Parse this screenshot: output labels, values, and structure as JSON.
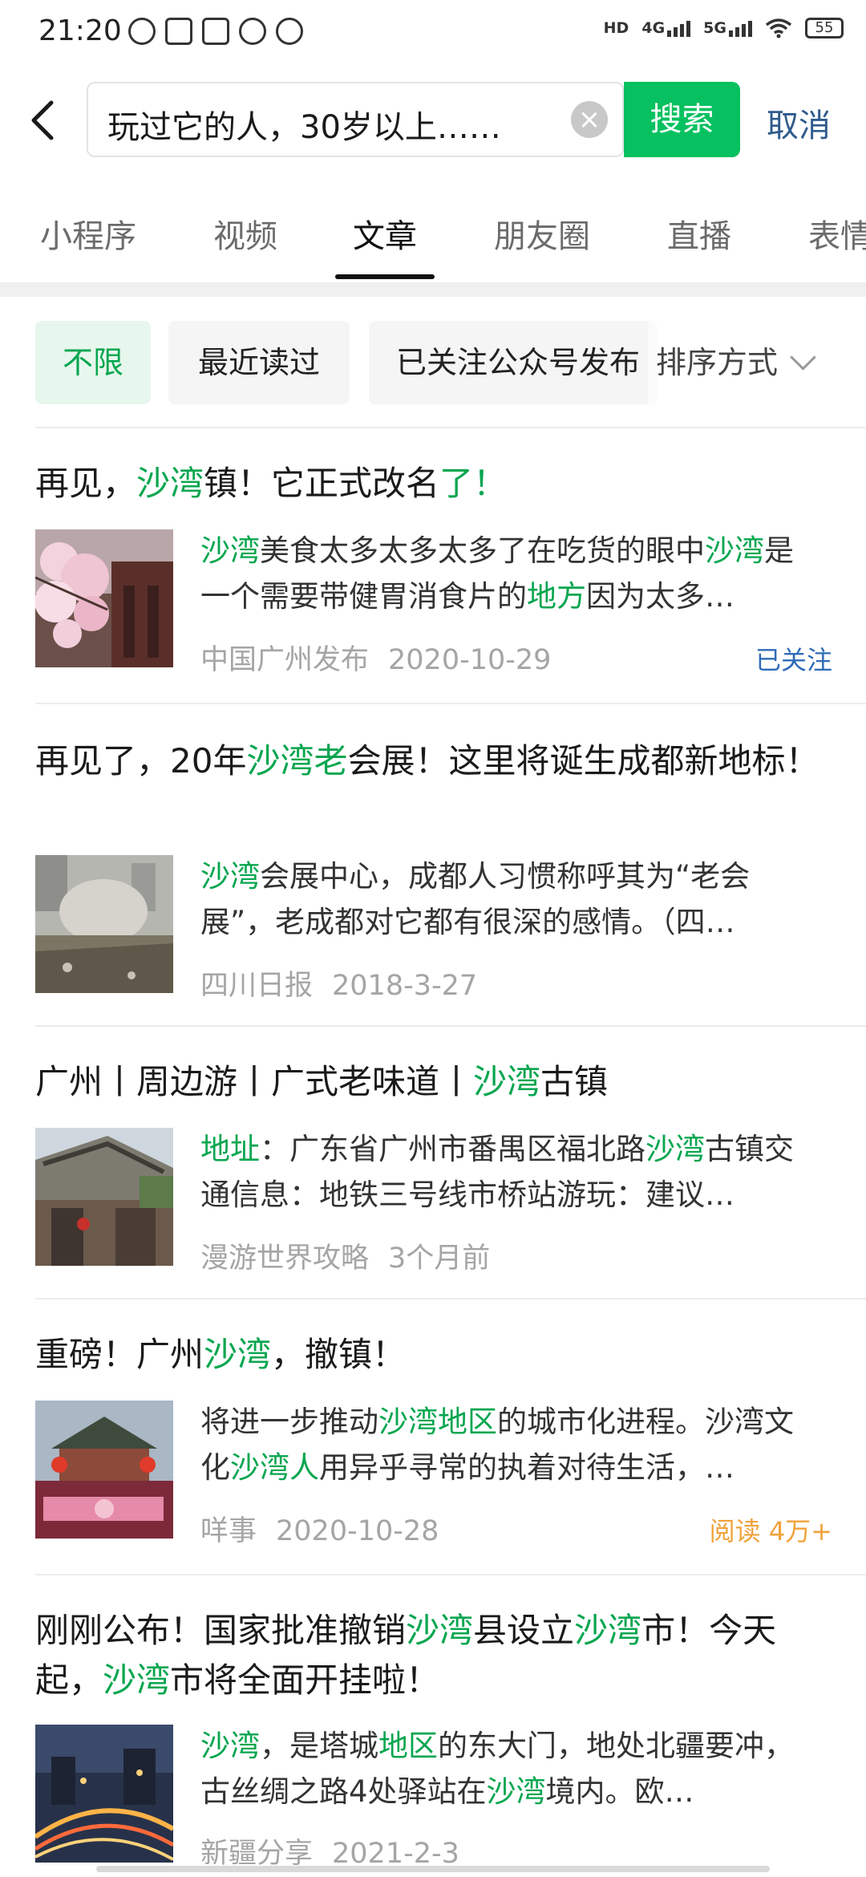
{
  "status_bar": {
    "time": "21:20",
    "network_left": "HD",
    "network_4g": "4G",
    "network_5g": "5G",
    "battery": "55"
  },
  "search": {
    "query": "玩过它的人，30岁以上……",
    "search_button": "搜索",
    "cancel": "取消"
  },
  "tabs": [
    "小程序",
    "视频",
    "文章",
    "朋友圈",
    "直播",
    "表情"
  ],
  "active_tab": "文章",
  "filters": {
    "chips": [
      "不限",
      "最近读过",
      "已关注公众号发布"
    ],
    "sort": "排序方式"
  },
  "articles": [
    {
      "title": [
        [
          "再见，",
          0
        ],
        [
          "沙湾",
          1
        ],
        [
          "镇！它正式改名",
          0
        ],
        [
          "了！",
          1
        ]
      ],
      "summary": [
        [
          "沙湾",
          1
        ],
        [
          "美食太多太多太多了在吃货的眼中",
          0
        ],
        [
          "沙湾",
          1
        ],
        [
          "是一个需要带健胃消食片的",
          0
        ],
        [
          "地方",
          1
        ],
        [
          "因为太多…",
          0
        ]
      ],
      "source": "中国广州发布",
      "date": "2020-10-29",
      "badge": "已关注",
      "thumb": "cherry-blossom-photo"
    },
    {
      "title": [
        [
          "再见了，20年",
          0
        ],
        [
          "沙湾老",
          1
        ],
        [
          "会展！这里将诞生成都新地标！",
          0
        ]
      ],
      "summary": [
        [
          "沙湾",
          1
        ],
        [
          "会展中心，成都人习惯称呼其为“老会展”，老成都对它都有很深的感情。（四…",
          0
        ]
      ],
      "source": "四川日报",
      "date": "2018-3-27",
      "badge": "",
      "thumb": "demolition-photo"
    },
    {
      "title": [
        [
          "广州丨周边游丨广式老味道丨",
          0
        ],
        [
          "沙湾",
          1
        ],
        [
          "古镇",
          0
        ]
      ],
      "summary": [
        [
          "地址",
          1
        ],
        [
          "：广东省广州市番禺区福北路",
          0
        ],
        [
          "沙湾",
          1
        ],
        [
          "古镇交通信息：地铁三号线市桥站游玩：建议…",
          0
        ]
      ],
      "source": "漫游世界攻略",
      "date": "3个月前",
      "badge": "",
      "thumb": "old-town-photo"
    },
    {
      "title": [
        [
          "重磅！广州",
          0
        ],
        [
          "沙湾",
          1
        ],
        [
          "，撤镇！",
          0
        ]
      ],
      "summary": [
        [
          "将进一步推动",
          0
        ],
        [
          "沙湾地区",
          1
        ],
        [
          "的城市化进程。沙湾文化",
          0
        ],
        [
          "沙湾人",
          1
        ],
        [
          "用异乎寻常的执着对待生活，…",
          0
        ]
      ],
      "source": "咩事",
      "date": "2020-10-28",
      "badge": "阅读 4万+",
      "thumb": "pavilion-photo"
    },
    {
      "title": [
        [
          "刚刚公布！国家批准撤销",
          0
        ],
        [
          "沙湾",
          1
        ],
        [
          "县设立",
          0
        ],
        [
          "沙湾",
          1
        ],
        [
          "市！今天起，",
          0
        ],
        [
          "沙湾",
          1
        ],
        [
          "市将全面开挂啦！",
          0
        ]
      ],
      "summary": [
        [
          "沙湾",
          1
        ],
        [
          "，是塔城",
          0
        ],
        [
          "地区",
          1
        ],
        [
          "的东大门，地处北疆要冲，古丝绸之路4处驿站在",
          0
        ],
        [
          "沙湾",
          1
        ],
        [
          "境内。欧…",
          0
        ]
      ],
      "source": "新疆分享",
      "date": "2021-2-3",
      "badge": "",
      "thumb": "city-night-photo"
    }
  ],
  "colors": {
    "accent": "#07c160",
    "highlight": "#07a64f",
    "cancel": "#2f5b8c",
    "followed_badge": "#2e6bb8",
    "reads_badge": "#f0a23b"
  }
}
